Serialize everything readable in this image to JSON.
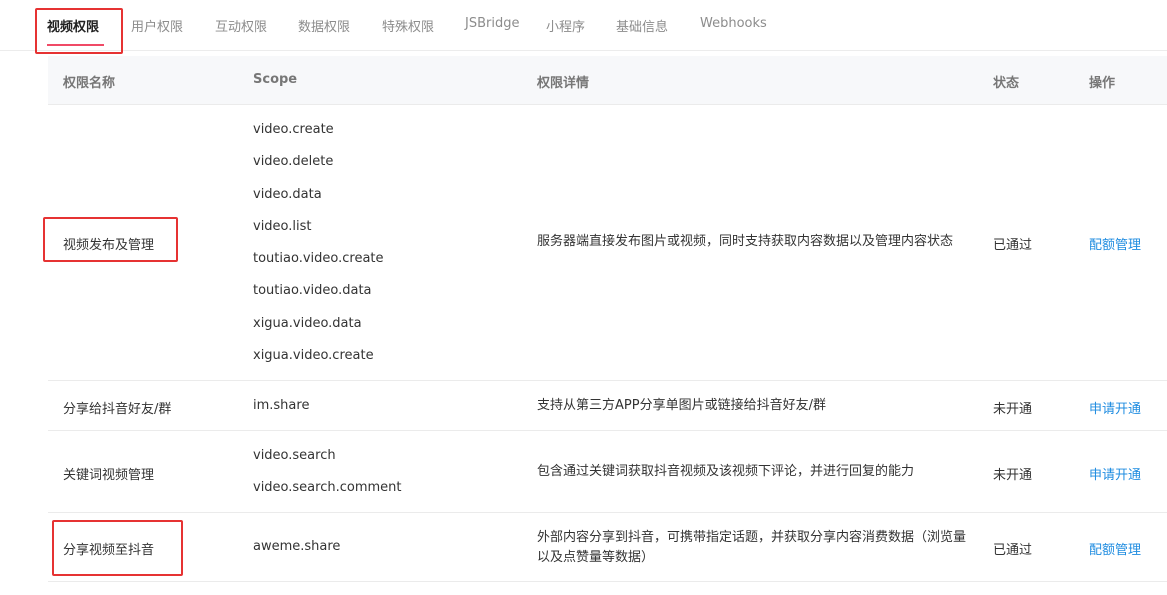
{
  "tabs": [
    {
      "label": "视频权限",
      "active": true
    },
    {
      "label": "用户权限"
    },
    {
      "label": "互动权限"
    },
    {
      "label": "数据权限"
    },
    {
      "label": "特殊权限"
    },
    {
      "label": "JSBridge"
    },
    {
      "label": "小程序"
    },
    {
      "label": "基础信息"
    },
    {
      "label": "Webhooks"
    }
  ],
  "table": {
    "headers": {
      "name": "权限名称",
      "scope": "Scope",
      "detail": "权限详情",
      "status": "状态",
      "action": "操作"
    },
    "rows": [
      {
        "name": "视频发布及管理",
        "scopes": [
          "video.create",
          "video.delete",
          "video.data",
          "video.list",
          "toutiao.video.create",
          "toutiao.video.data",
          "xigua.video.data",
          "xigua.video.create"
        ],
        "detail": "服务器端直接发布图片或视频，同时支持获取内容数据以及管理内容状态",
        "status": "已通过",
        "action": "配额管理"
      },
      {
        "name": "分享给抖音好友/群",
        "scopes": [
          "im.share"
        ],
        "detail": "支持从第三方APP分享单图片或链接给抖音好友/群",
        "status": "未开通",
        "action": "申请开通"
      },
      {
        "name": "关键词视频管理",
        "scopes": [
          "video.search",
          "video.search.comment"
        ],
        "detail": "包含通过关键词获取抖音视频及该视频下评论，并进行回复的能力",
        "status": "未开通",
        "action": "申请开通"
      },
      {
        "name": "分享视频至抖音",
        "scopes": [
          "aweme.share"
        ],
        "detail": "外部内容分享到抖音，可携带指定话题，并获取分享内容消费数据（浏览量以及点赞量等数据）",
        "status": "已通过",
        "action": "配额管理"
      }
    ]
  }
}
